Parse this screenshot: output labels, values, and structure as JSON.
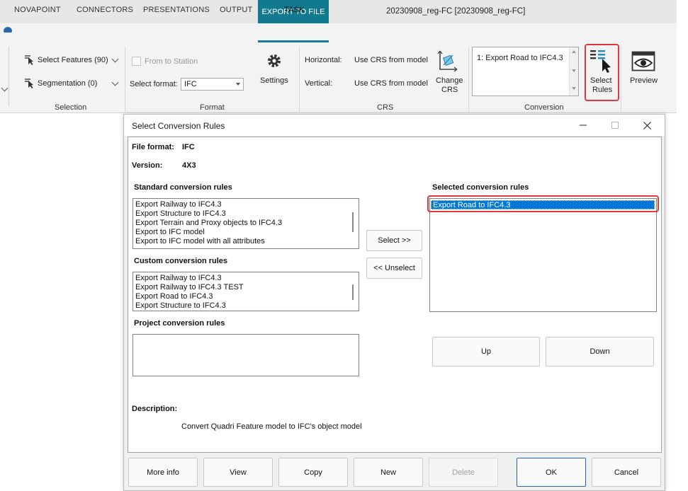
{
  "ribbon": {
    "export_tab": "EXPORT TO FILE",
    "doc_title": "20230908_reg-FC  [20230908_reg-FC]",
    "tabs": [
      "NOVAPOINT",
      "CONNECTORS",
      "PRESENTATIONS",
      "OUTPUT",
      "TASK"
    ],
    "active_tab": "TASK",
    "selection": {
      "select_features": "Select Features (90)",
      "segmentation": "Segmentation (0)",
      "label": "Selection"
    },
    "format": {
      "from_station": "From to Station",
      "select_format_label": "Select format:",
      "select_format_value": "IFC",
      "settings": "Settings",
      "label": "Format"
    },
    "crs": {
      "horizontal_label": "Horizontal:",
      "horizontal_value": "Use CRS from model",
      "vertical_label": "Vertical:",
      "vertical_value": "Use CRS from model",
      "change_crs_1": "Change",
      "change_crs_2": "CRS",
      "label": "CRS"
    },
    "conversion": {
      "list_item": "1: Export Road to IFC4.3",
      "select_rules_1": "Select",
      "select_rules_2": "Rules",
      "label": "Conversion"
    },
    "preview": "Preview"
  },
  "dialog": {
    "title": "Select Conversion Rules",
    "file_format_label": "File format:",
    "file_format_value": "IFC",
    "version_label": "Version:",
    "version_value": "4X3",
    "standard_title": "Standard conversion rules",
    "standard_rules": [
      "Export Railway to IFC4.3",
      "Export Structure to IFC4.3",
      "Export Terrain and Proxy objects to IFC4.3",
      "Export to IFC model",
      "Export to IFC model with all attributes"
    ],
    "custom_title": "Custom conversion rules",
    "custom_rules": [
      "Export Railway to IFC4.3",
      "Export Railway to IFC4.3  TEST",
      "Export Road to IFC4.3",
      "Export Structure to IFC4.3"
    ],
    "project_title": "Project conversion rules",
    "selected_title": "Selected conversion rules",
    "selected_rules": [
      "Export Road to IFC4.3"
    ],
    "select_btn": "Select >>",
    "unselect_btn": "<< Unselect",
    "up_btn": "Up",
    "down_btn": "Down",
    "description_label": "Description:",
    "description_text": "Convert Quadri Feature model to IFC's object model",
    "footer": {
      "more_info": "More info",
      "view": "View",
      "copy": "Copy",
      "new": "New",
      "delete": "Delete",
      "ok": "OK",
      "cancel": "Cancel"
    }
  },
  "colors": {
    "accent_teal": "#127a8f",
    "selection_blue": "#0078d7",
    "highlight_red": "#e0383f"
  }
}
